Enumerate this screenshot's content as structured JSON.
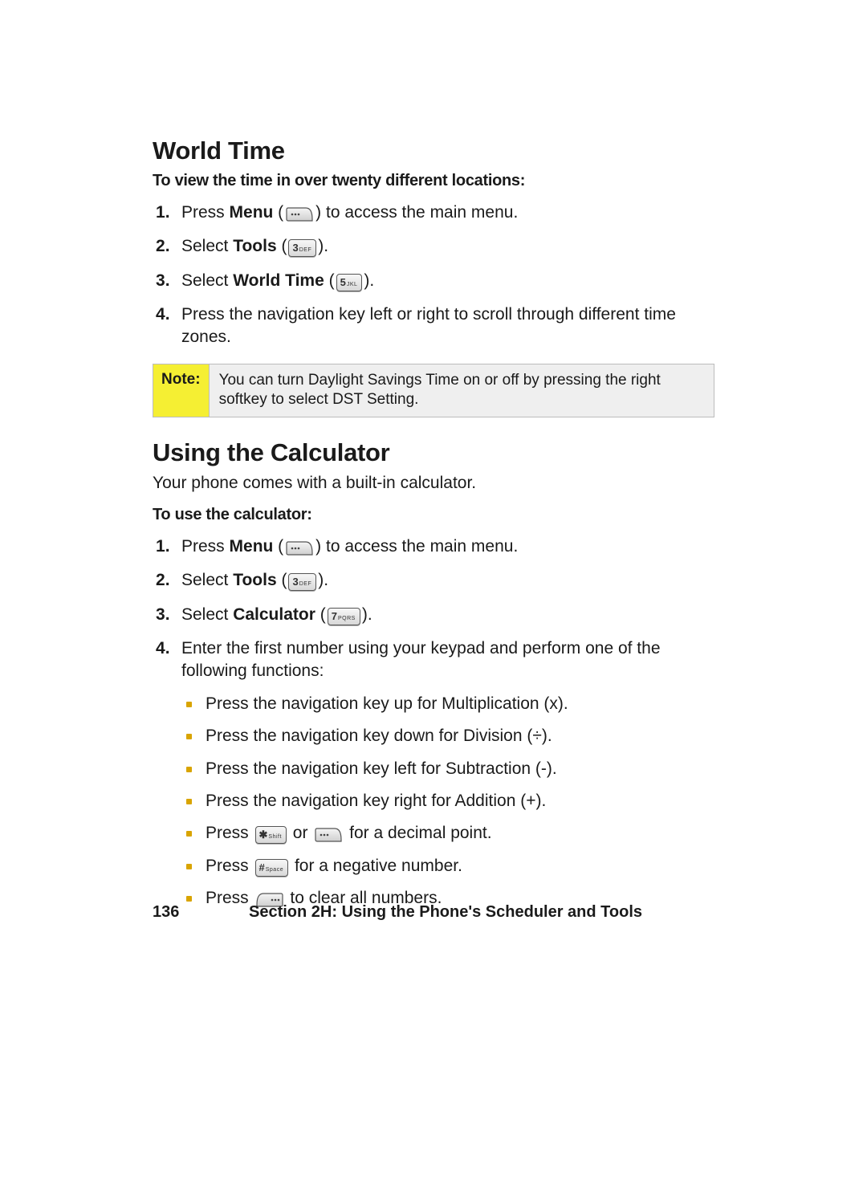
{
  "sections": {
    "worldTime": {
      "heading": "World Time",
      "lead": "To view the time in over twenty different locations:",
      "steps": {
        "s1_pre": "Press ",
        "s1_b": "Menu",
        "s1_post": " to access the main menu.",
        "s2_pre": "Select ",
        "s2_b": "Tools",
        "s2_post": ".",
        "s3_pre": "Select ",
        "s3_b": "World Time",
        "s3_post": ".",
        "s4": "Press the navigation key left or right to scroll through different time zones."
      }
    },
    "note": {
      "label": "Note:",
      "text": "You can turn Daylight Savings Time on or off by pressing the right softkey to select DST Setting."
    },
    "calc": {
      "heading": "Using the Calculator",
      "intro": "Your phone comes with a built-in calculator.",
      "lead": "To use the calculator:",
      "steps": {
        "s1_pre": "Press ",
        "s1_b": "Menu",
        "s1_post": " to access the main menu.",
        "s2_pre": "Select ",
        "s2_b": "Tools",
        "s2_post": ".",
        "s3_pre": "Select ",
        "s3_b": "Calculator",
        "s3_post": ".",
        "s4": "Enter the first number using your keypad and perform one of the following functions:"
      },
      "sub": {
        "i1": "Press the navigation key up for Multiplication (x).",
        "i2": "Press the navigation key down for Division (÷).",
        "i3": "Press the navigation key left for Subtraction (-).",
        "i4": "Press the navigation key right for Addition (+).",
        "i5_pre": "Press ",
        "i5_mid": " or ",
        "i5_post": " for a decimal point.",
        "i6_pre": "Press ",
        "i6_post": " for a negative number.",
        "i7_pre": "Press ",
        "i7_post": " to clear all numbers."
      }
    }
  },
  "keys": {
    "k3_digit": "3",
    "k3_label": "DEF",
    "k5_digit": "5",
    "k5_label": "JKL",
    "k7_digit": "7",
    "k7_label": "PQRS",
    "star_digit": "✱",
    "star_label": "Shift",
    "hash_digit": "#",
    "hash_label": "Space"
  },
  "footer": {
    "page": "136",
    "text": "Section 2H: Using the Phone's Scheduler and Tools"
  }
}
